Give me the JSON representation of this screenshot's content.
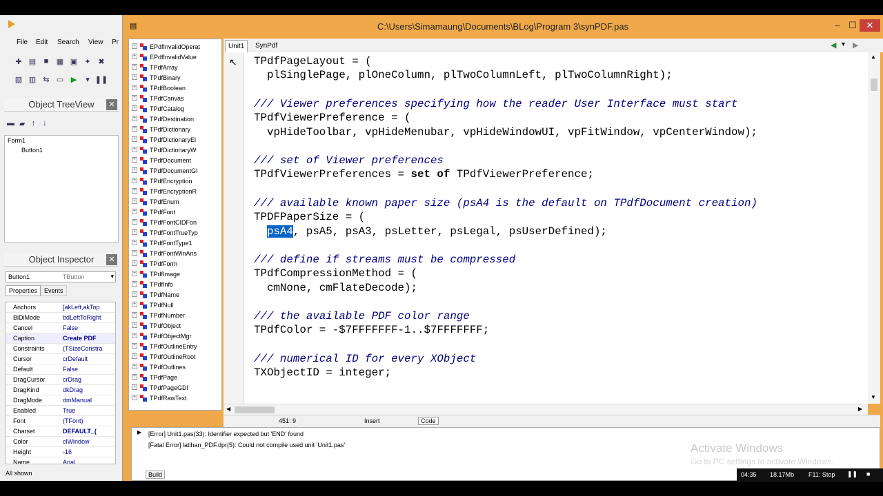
{
  "ide": {
    "menu": [
      "File",
      "Edit",
      "Search",
      "View",
      "Pr"
    ],
    "tree_title": "Object TreeView",
    "tree_nodes": [
      "Form1",
      "Button1"
    ],
    "inspector_title": "Object Inspector",
    "selected_component": "Button1",
    "selected_type": "TButton",
    "inspector_tabs": [
      "Properties",
      "Events"
    ],
    "properties": [
      {
        "name": "Anchors",
        "value": "[akLeft,akTop"
      },
      {
        "name": "BiDiMode",
        "value": "bdLeftToRight"
      },
      {
        "name": "Cancel",
        "value": "False"
      },
      {
        "name": "Caption",
        "value": "Create PDF"
      },
      {
        "name": "Constraints",
        "value": "(TSizeConstra"
      },
      {
        "name": "Cursor",
        "value": "crDefault"
      },
      {
        "name": "Default",
        "value": "False"
      },
      {
        "name": "DragCursor",
        "value": "crDrag"
      },
      {
        "name": "DragKind",
        "value": "dkDrag"
      },
      {
        "name": "DragMode",
        "value": "dmManual"
      },
      {
        "name": "Enabled",
        "value": "True"
      },
      {
        "name": "Font",
        "value": "(TFont)"
      },
      {
        "name": "Charset",
        "value": "DEFAULT_("
      },
      {
        "name": "Color",
        "value": "clWindow"
      },
      {
        "name": "Height",
        "value": "-16"
      },
      {
        "name": "Name",
        "value": "Arial"
      }
    ],
    "all_shown": "All shown"
  },
  "editor": {
    "title": "C:\\Users\\Simamaung\\Documents\\BLog\\Program 3\\synPDF.pas",
    "tabs": [
      "Unit1",
      "SynPdf"
    ],
    "units": [
      "EPdfInvalidOperat",
      "EPdfInvalidValue",
      "TPdfArray",
      "TPdfBinary",
      "TPdfBoolean",
      "TPdfCanvas",
      "TPdfCatalog",
      "TPdfDestination",
      "TPdfDictionary",
      "TPdfDictionaryEl",
      "TPdfDictionaryW",
      "TPdfDocument",
      "TPdfDocumentGI",
      "TPdfEncryption",
      "TPdfEncryptionR",
      "TPdfEnum",
      "TPdfFont",
      "TPdfFontCIDFon",
      "TPdfFontTrueTyp",
      "TPdfFontType1",
      "TPdfFontWinAns",
      "TPdfForm",
      "TPdfImage",
      "TPdfInfo",
      "TPdfName",
      "TPdfNull",
      "TPdfNumber",
      "TPdfObject",
      "TPdfObjectMgr",
      "TPdfOutlineEntry",
      "TPdfOutlineRoot",
      "TPdfOutlines",
      "TPdfPage",
      "TPdfPageGDI",
      "TPdfRawText"
    ],
    "code": {
      "l1": "TPdfPageLayout = (",
      "l2": "  plSinglePage, plOneColumn, plTwoColumnLeft, plTwoColumnRight);",
      "l4": "/// Viewer preferences specifying how the reader User Interface must start",
      "l5": "TPdfViewerPreference = (",
      "l6": "  vpHideToolbar, vpHideMenubar, vpHideWindowUI, vpFitWindow, vpCenterWindow);",
      "l8": "/// set of Viewer preferences",
      "l9a": "TPdfViewerPreferences = ",
      "l9b": "set of",
      "l9c": " TPdfViewerPreference;",
      "l11": "/// available known paper size (psA4 is the default on TPdfDocument creation)",
      "l12": "TPDFPaperSize = (",
      "l13a": "psA4",
      "l13b": ", psA5, psA3, psLetter, psLegal, psUserDefined);",
      "l15": "/// define if streams must be compressed",
      "l16": "TPdfCompressionMethod = (",
      "l17": "  cmNone, cmFlateDecode);",
      "l19": "/// the available PDF color range",
      "l20": "TPdfColor = -$7FFFFFFF-1..$7FFFFFFF;",
      "l22": "/// numerical ID for every XObject",
      "l23": "TXObjectID = integer;"
    },
    "status": {
      "position": "451:  9",
      "mode": "Insert",
      "tab": "Code"
    },
    "messages": [
      "[Error] Unit1.pas(33): Identifier expected but 'END' found",
      "[Fatal Error] latihan_PDF.dpr(5): Could not compile used unit 'Unit1.pas'"
    ],
    "messages_tab": "Build"
  },
  "watermark": {
    "line1": "Activate Windows",
    "line2": "Go to PC settings to activate Windows."
  },
  "taskbar": {
    "time": "04:35",
    "memory": "18.17Mb",
    "hint": "F11: Stop"
  }
}
